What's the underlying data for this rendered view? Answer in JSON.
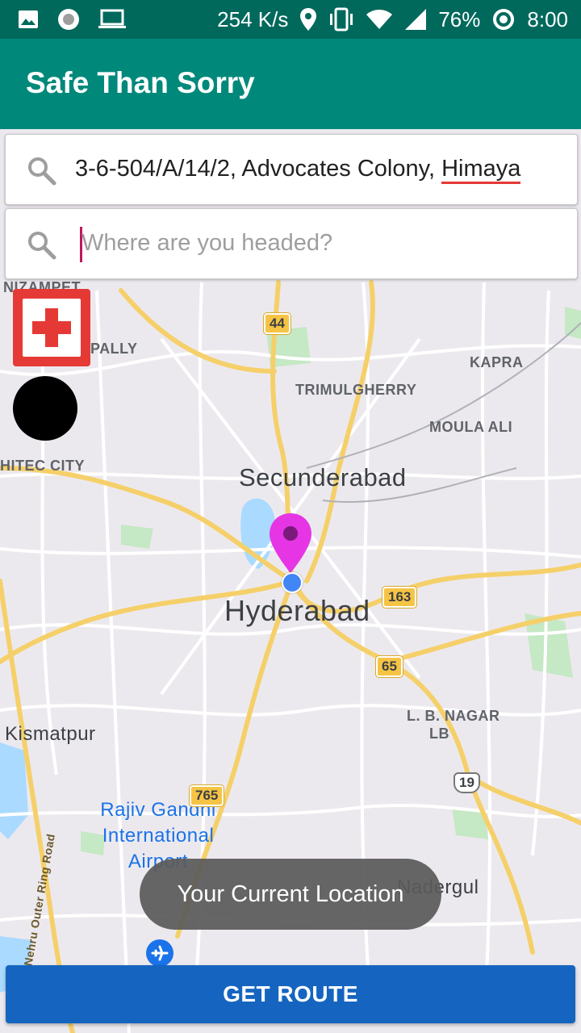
{
  "status_bar": {
    "speed": "254 K/s",
    "battery": "76%",
    "time": "8:00",
    "icons": [
      "image-icon",
      "circle-icon",
      "laptop-icon",
      "location-icon",
      "vibrate-icon",
      "wifi-icon",
      "signal-icon",
      "sync-icon"
    ]
  },
  "app_bar": {
    "title": "Safe Than Sorry"
  },
  "search": {
    "origin_value_prefix": "3-6-504/A/14/2, Advocates Colony, ",
    "origin_value_spell": "Himaya",
    "destination_placeholder": "Where are you headed?"
  },
  "map": {
    "labels": {
      "nizampet": "NIZAMPET",
      "pally": "PALLY",
      "kapra": "KAPRA",
      "trimulgherry": "TRIMULGHERRY",
      "moula_ali": "MOULA ALI",
      "hitec_city": "HITEC CITY",
      "secunderabad": "Secunderabad",
      "hyderabad": "Hyderabad",
      "kismatpur": "Kismatpur",
      "lb_nagar": "L. B. NAGAR",
      "lb": "LB",
      "airport_line1": "Rajiv Gandhi",
      "airport_line2": "International",
      "airport_line3": "Airport",
      "nadergul": "Nadergul",
      "ring_road": "Nehru Outer Ring Road"
    },
    "shields": {
      "r44": "44",
      "r163": "163",
      "r65": "65",
      "r765": "765",
      "r19": "19"
    },
    "colors": {
      "marker": "#e535e5",
      "current_location": "#4285f4"
    }
  },
  "toast": {
    "text": "Your Current Location"
  },
  "route_button": {
    "label": "GET ROUTE"
  },
  "colors": {
    "status_bar": "#00695c",
    "app_bar": "#00897b",
    "route_button": "#1565c0",
    "first_aid": "#e53935"
  }
}
